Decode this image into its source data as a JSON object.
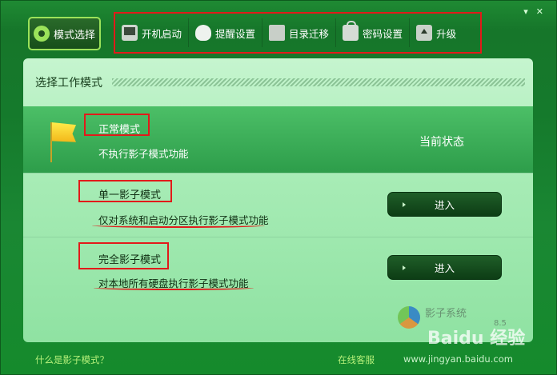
{
  "window_controls": {
    "menu": "▾",
    "close": "✕"
  },
  "mode_tab": {
    "label": "模式选择"
  },
  "toolbar": {
    "items": [
      {
        "label": "开机启动",
        "icon": "monitor-icon"
      },
      {
        "label": "提醒设置",
        "icon": "bulb-icon"
      },
      {
        "label": "目录迁移",
        "icon": "folder-icon"
      },
      {
        "label": "密码设置",
        "icon": "lock-icon"
      },
      {
        "label": "升级",
        "icon": "upgrade-icon"
      }
    ]
  },
  "panel": {
    "title": "选择工作模式",
    "normal": {
      "name": "正常模式",
      "desc": "不执行影子模式功能",
      "status": "当前状态"
    },
    "single": {
      "name": "单一影子模式",
      "desc": "仅对系统和启动分区执行影子模式功能",
      "button": "进入"
    },
    "full": {
      "name": "完全影子模式",
      "desc": "对本地所有硬盘执行影子模式功能",
      "button": "进入"
    },
    "brand": {
      "text": "影子系统",
      "version": "8.5"
    }
  },
  "footer": {
    "help": "什么是影子模式？",
    "support": "在线客服",
    "site": "www.jingyan.baidu.com"
  },
  "watermark": "Baidu 经验",
  "colors": {
    "accent": "#9be25a",
    "highlight": "#e21a1a",
    "panel": "#a8ecb6"
  }
}
